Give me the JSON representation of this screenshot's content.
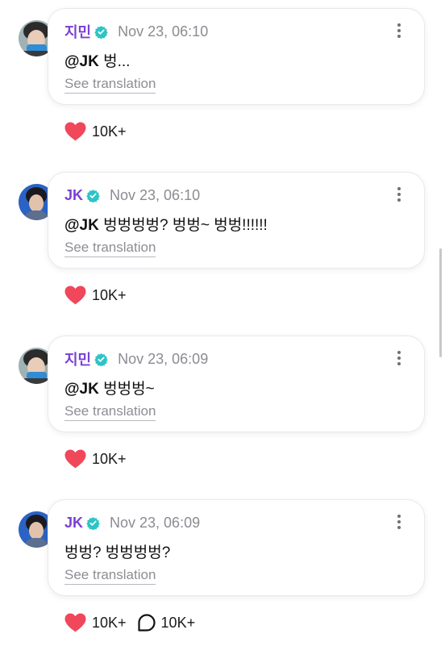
{
  "posts": [
    {
      "author": "지민",
      "author_color": "#7a3fd6",
      "verified_icon": "verified-badge-icon",
      "timestamp": "Nov 23, 06:10",
      "mention": "@JK",
      "text": " 벙...",
      "translate_label": "See translation",
      "likes": "10K+",
      "avatar": "jimin-avatar"
    },
    {
      "author": "JK",
      "author_color": "#7a3fd6",
      "verified_icon": "verified-badge-icon",
      "timestamp": "Nov 23, 06:10",
      "mention": "@JK",
      "text": " 벙벙벙벙? 벙벙~ 벙벙!!!!!!",
      "translate_label": "See translation",
      "likes": "10K+",
      "avatar": "jk-avatar"
    },
    {
      "author": "지민",
      "author_color": "#7a3fd6",
      "verified_icon": "verified-badge-icon",
      "timestamp": "Nov 23, 06:09",
      "mention": "@JK",
      "text": " 벙벙벙~",
      "translate_label": "See translation",
      "likes": "10K+",
      "avatar": "jimin-avatar"
    },
    {
      "author": "JK",
      "author_color": "#7a3fd6",
      "verified_icon": "verified-badge-icon",
      "timestamp": "Nov 23, 06:09",
      "mention": "",
      "text": "벙벙? 벙벙벙벙?",
      "translate_label": "See translation",
      "likes": "10K+",
      "comments": "10K+",
      "avatar": "jk-avatar"
    }
  ],
  "colors": {
    "heart": "#f0475a",
    "verified": "#2ec4c6",
    "timestamp": "#8b8b92"
  }
}
